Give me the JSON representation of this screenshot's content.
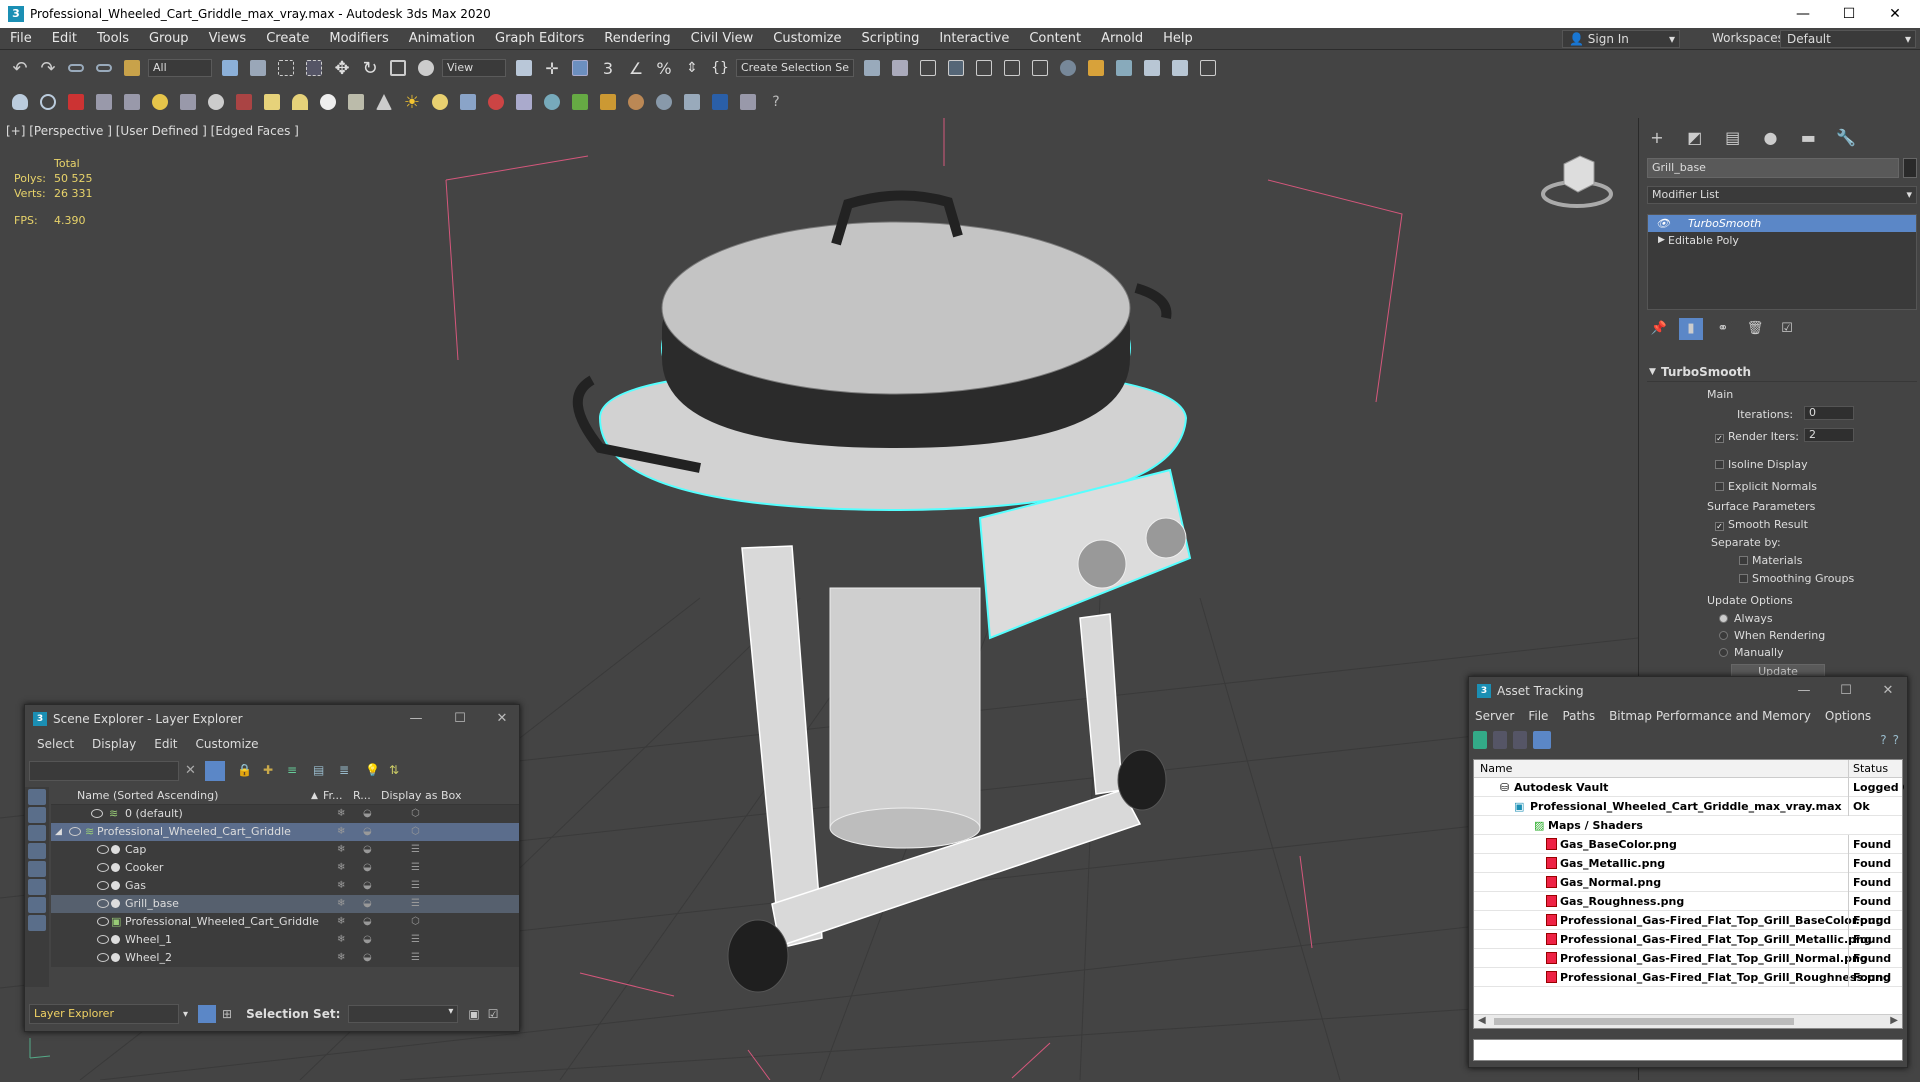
{
  "window": {
    "title": "Professional_Wheeled_Cart_Griddle_max_vray.max - Autodesk 3ds Max 2020",
    "minimize": "—",
    "maximize": "☐",
    "close": "✕"
  },
  "menu": [
    "File",
    "Edit",
    "Tools",
    "Group",
    "Views",
    "Create",
    "Modifiers",
    "Animation",
    "Graph Editors",
    "Rendering",
    "Civil View",
    "Customize",
    "Scripting",
    "Interactive",
    "Content",
    "Arnold",
    "Help"
  ],
  "account": {
    "sign_in": "Sign In",
    "workspaces_label": "Workspaces:",
    "workspace": "Default"
  },
  "toolbar1": {
    "filter": "All",
    "ref_coord": "View",
    "selection_set": "Create Selection Se"
  },
  "viewport": {
    "label": "[+] [Perspective ] [User Defined ] [Edged Faces ]",
    "stats": {
      "total_label": "Total",
      "polys_label": "Polys:",
      "polys": "50 525",
      "verts_label": "Verts:",
      "verts": "26 331",
      "fps_label": "FPS:",
      "fps": "4.390"
    }
  },
  "command_panel": {
    "object_name": "Grill_base",
    "modifier_list": "Modifier List",
    "stack": [
      "TurboSmooth",
      "Editable Poly"
    ],
    "rollout_title": "TurboSmooth",
    "main_label": "Main",
    "iterations_label": "Iterations:",
    "iterations": "0",
    "render_iters_label": "Render Iters:",
    "render_iters": "2",
    "isoline": "Isoline Display",
    "explicit_normals": "Explicit Normals",
    "surface_params": "Surface Parameters",
    "smooth_result": "Smooth Result",
    "separate_by": "Separate by:",
    "materials": "Materials",
    "smoothing_groups": "Smoothing Groups",
    "update_options": "Update Options",
    "always": "Always",
    "when_rendering": "When Rendering",
    "manually": "Manually",
    "update": "Update"
  },
  "scene_explorer": {
    "title": "Scene Explorer - Layer Explorer",
    "menu": [
      "Select",
      "Display",
      "Edit",
      "Customize"
    ],
    "columns": {
      "name": "Name (Sorted Ascending)",
      "frozen": "Fr...",
      "render": "R...",
      "box": "Display as Box"
    },
    "rows": [
      {
        "name": "0 (default)"
      },
      {
        "name": "Professional_Wheeled_Cart_Griddle"
      },
      {
        "name": "Cap"
      },
      {
        "name": "Cooker"
      },
      {
        "name": "Gas"
      },
      {
        "name": "Grill_base"
      },
      {
        "name": "Professional_Wheeled_Cart_Griddle"
      },
      {
        "name": "Wheel_1"
      },
      {
        "name": "Wheel_2"
      }
    ],
    "bottom_label": "Layer Explorer",
    "selection_set_label": "Selection Set:"
  },
  "asset_tracking": {
    "title": "Asset Tracking",
    "menu": [
      "Server",
      "File",
      "Paths",
      "Bitmap Performance and Memory",
      "Options"
    ],
    "col_name": "Name",
    "col_status": "Status",
    "rows": [
      {
        "name": "Autodesk Vault",
        "status": "Logged O"
      },
      {
        "name": "Professional_Wheeled_Cart_Griddle_max_vray.max",
        "status": "Ok"
      },
      {
        "name": "Maps / Shaders",
        "status": ""
      },
      {
        "name": "Gas_BaseColor.png",
        "status": "Found"
      },
      {
        "name": "Gas_Metallic.png",
        "status": "Found"
      },
      {
        "name": "Gas_Normal.png",
        "status": "Found"
      },
      {
        "name": "Gas_Roughness.png",
        "status": "Found"
      },
      {
        "name": "Professional_Gas-Fired_Flat_Top_Grill_BaseColor.png",
        "status": "Found"
      },
      {
        "name": "Professional_Gas-Fired_Flat_Top_Grill_Metallic.png",
        "status": "Found"
      },
      {
        "name": "Professional_Gas-Fired_Flat_Top_Grill_Normal.png",
        "status": "Found"
      },
      {
        "name": "Professional_Gas-Fired_Flat_Top_Grill_Roughness.png",
        "status": "Found"
      }
    ]
  }
}
